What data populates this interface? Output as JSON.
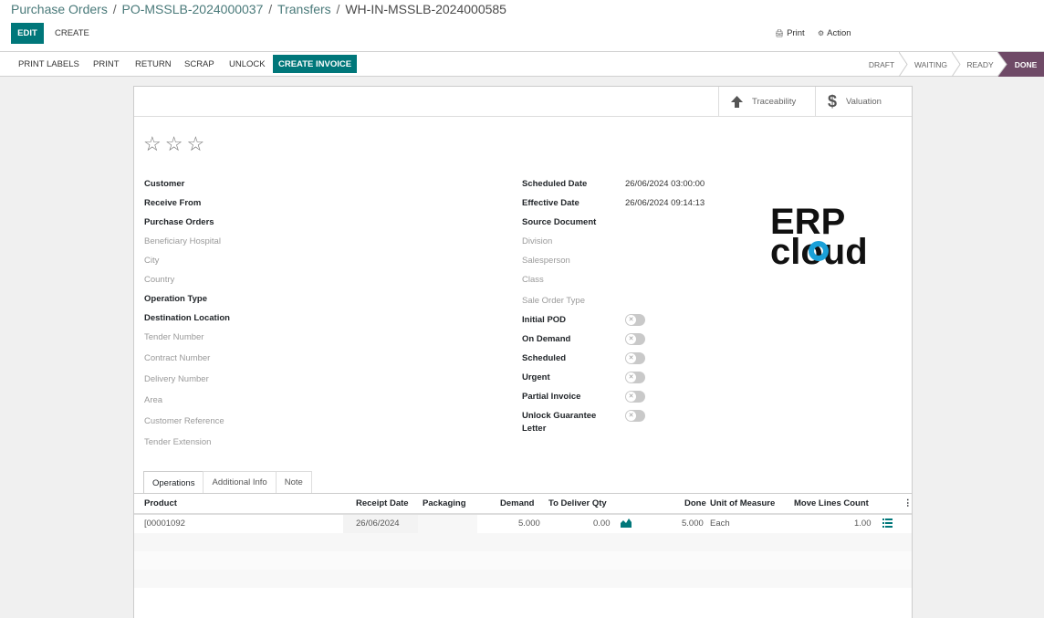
{
  "breadcrumb": {
    "items": [
      "Purchase Orders",
      "PO-MSSLB-2024000037",
      "Transfers"
    ],
    "current": "WH-IN-MSSLB-2024000585"
  },
  "control": {
    "edit": "EDIT",
    "create": "CREATE",
    "print": "Print",
    "action": "Action"
  },
  "toolbar": {
    "buttons": [
      "PRINT LABELS",
      "PRINT",
      "RETURN",
      "SCRAP",
      "UNLOCK"
    ],
    "primary": "CREATE INVOICE"
  },
  "stages": [
    "DRAFT",
    "WAITING",
    "READY",
    "DONE"
  ],
  "smart_buttons": {
    "traceability": "Traceability",
    "valuation": "Valuation"
  },
  "left_fields": [
    {
      "label": "Customer",
      "required": true
    },
    {
      "label": "Receive From",
      "required": true
    },
    {
      "label": "Purchase Orders",
      "required": true
    },
    {
      "label": "Beneficiary Hospital",
      "required": false
    },
    {
      "label": "City",
      "required": false
    },
    {
      "label": "Country",
      "required": false
    },
    {
      "label": "Operation Type",
      "required": true
    },
    {
      "label": "Destination Location",
      "required": true
    },
    {
      "label": "Tender Number",
      "required": false
    },
    {
      "label": "Contract Number",
      "required": false
    },
    {
      "label": "Delivery Number",
      "required": false
    },
    {
      "label": "Area",
      "required": false
    },
    {
      "label": "Customer Reference",
      "required": false
    },
    {
      "label": "Tender Extension",
      "required": false
    }
  ],
  "right_fields": {
    "scheduled_date": {
      "label": "Scheduled Date",
      "value": "26/06/2024 03:00:00"
    },
    "effective_date": {
      "label": "Effective Date",
      "value": "26/06/2024 09:14:13"
    },
    "source_document": {
      "label": "Source Document"
    },
    "division": {
      "label": "Division"
    },
    "salesperson": {
      "label": "Salesperson"
    },
    "class": {
      "label": "Class"
    },
    "sale_order_type": {
      "label": "Sale Order Type"
    }
  },
  "toggles": [
    {
      "label": "Initial POD",
      "on": false
    },
    {
      "label": "On Demand",
      "on": false
    },
    {
      "label": "Scheduled",
      "on": false
    },
    {
      "label": "Urgent",
      "on": false
    },
    {
      "label": "Partial Invoice",
      "on": false
    },
    {
      "label_line1": "Unlock Guarantee",
      "label_line2": "Letter",
      "on": false
    }
  ],
  "logo": {
    "line1": "ERP",
    "line2": "cloud",
    "accent": "#1aa0d8"
  },
  "tabs": [
    "Operations",
    "Additional Info",
    "Note"
  ],
  "table": {
    "headers": {
      "product": "Product",
      "receipt_date": "Receipt Date",
      "packaging": "Packaging",
      "demand": "Demand",
      "to_deliver": "To Deliver Qty",
      "done": "Done",
      "uom": "Unit of Measure",
      "move_lines": "Move Lines Count"
    },
    "rows": [
      {
        "product": "[00001092",
        "receipt_date": "26/06/2024",
        "packaging": "",
        "demand": "5.000",
        "to_deliver": "0.00",
        "done": "5.000",
        "uom": "Each",
        "move_lines": "1.00"
      }
    ]
  },
  "colors": {
    "primary": "#00777a",
    "done_stage": "#6f4a67"
  }
}
